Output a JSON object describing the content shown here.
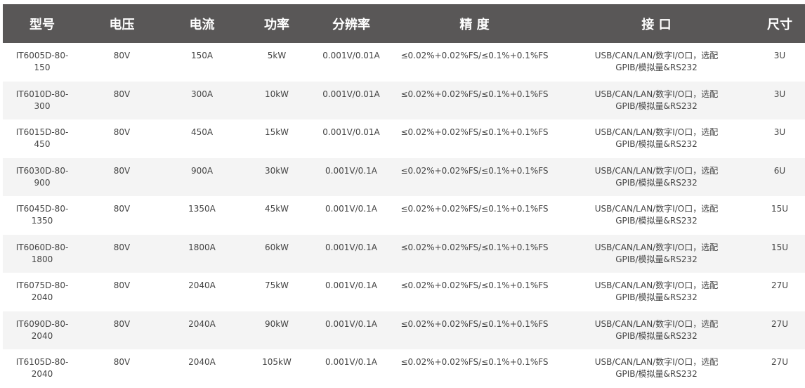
{
  "table": {
    "headers": [
      "型号",
      "电压",
      "电流",
      "功率",
      "分辨率",
      "精 度",
      "接 口",
      "尺寸"
    ],
    "rows": [
      {
        "model": "IT6005D-80-150",
        "voltage": "80V",
        "current": "150A",
        "power": "5kW",
        "resolution": "0.001V/0.01A",
        "accuracy": "≤0.02%+0.02%FS/≤0.1%+0.1%FS",
        "interface": "USB/CAN/LAN/数字I/O口，选配GPIB/模拟量&RS232",
        "size": "3U"
      },
      {
        "model": "IT6010D-80-300",
        "voltage": "80V",
        "current": "300A",
        "power": "10kW",
        "resolution": "0.001V/0.01A",
        "accuracy": "≤0.02%+0.02%FS/≤0.1%+0.1%FS",
        "interface": "USB/CAN/LAN/数字I/O口，选配GPIB/模拟量&RS232",
        "size": "3U"
      },
      {
        "model": "IT6015D-80-450",
        "voltage": "80V",
        "current": "450A",
        "power": "15kW",
        "resolution": "0.001V/0.01A",
        "accuracy": "≤0.02%+0.02%FS/≤0.1%+0.1%FS",
        "interface": "USB/CAN/LAN/数字I/O口，选配GPIB/模拟量&RS232",
        "size": "3U"
      },
      {
        "model": "IT6030D-80-900",
        "voltage": "80V",
        "current": "900A",
        "power": "30kW",
        "resolution": "0.001V/0.1A",
        "accuracy": "≤0.02%+0.02%FS/≤0.1%+0.1%FS",
        "interface": "USB/CAN/LAN/数字I/O口，选配GPIB/模拟量&RS232",
        "size": "6U"
      },
      {
        "model": "IT6045D-80-1350",
        "voltage": "80V",
        "current": "1350A",
        "power": "45kW",
        "resolution": "0.001V/0.1A",
        "accuracy": "≤0.02%+0.02%FS/≤0.1%+0.1%FS",
        "interface": "USB/CAN/LAN/数字I/O口，选配GPIB/模拟量&RS232",
        "size": "15U"
      },
      {
        "model": "IT6060D-80-1800",
        "voltage": "80V",
        "current": "1800A",
        "power": "60kW",
        "resolution": "0.001V/0.1A",
        "accuracy": "≤0.02%+0.02%FS/≤0.1%+0.1%FS",
        "interface": "USB/CAN/LAN/数字I/O口，选配GPIB/模拟量&RS232",
        "size": "15U"
      },
      {
        "model": "IT6075D-80-2040",
        "voltage": "80V",
        "current": "2040A",
        "power": "75kW",
        "resolution": "0.001V/0.1A",
        "accuracy": "≤0.02%+0.02%FS/≤0.1%+0.1%FS",
        "interface": "USB/CAN/LAN/数字I/O口，选配GPIB/模拟量&RS232",
        "size": "27U"
      },
      {
        "model": "IT6090D-80-2040",
        "voltage": "80V",
        "current": "2040A",
        "power": "90kW",
        "resolution": "0.001V/0.1A",
        "accuracy": "≤0.02%+0.02%FS/≤0.1%+0.1%FS",
        "interface": "USB/CAN/LAN/数字I/O口，选配GPIB/模拟量&RS232",
        "size": "27U"
      },
      {
        "model": "IT6105D-80-2040",
        "voltage": "80V",
        "current": "2040A",
        "power": "105kW",
        "resolution": "0.001V/0.1A",
        "accuracy": "≤0.02%+0.02%FS/≤0.1%+0.1%FS",
        "interface": "USB/CAN/LAN/数字I/O口，选配GPIB/模拟量&RS232",
        "size": "27U"
      }
    ]
  },
  "colors": {
    "header_bg": "#595757",
    "header_text": "#ffffff",
    "row_alt_bg": "#f4f4f4",
    "cell_text": "#444444"
  }
}
